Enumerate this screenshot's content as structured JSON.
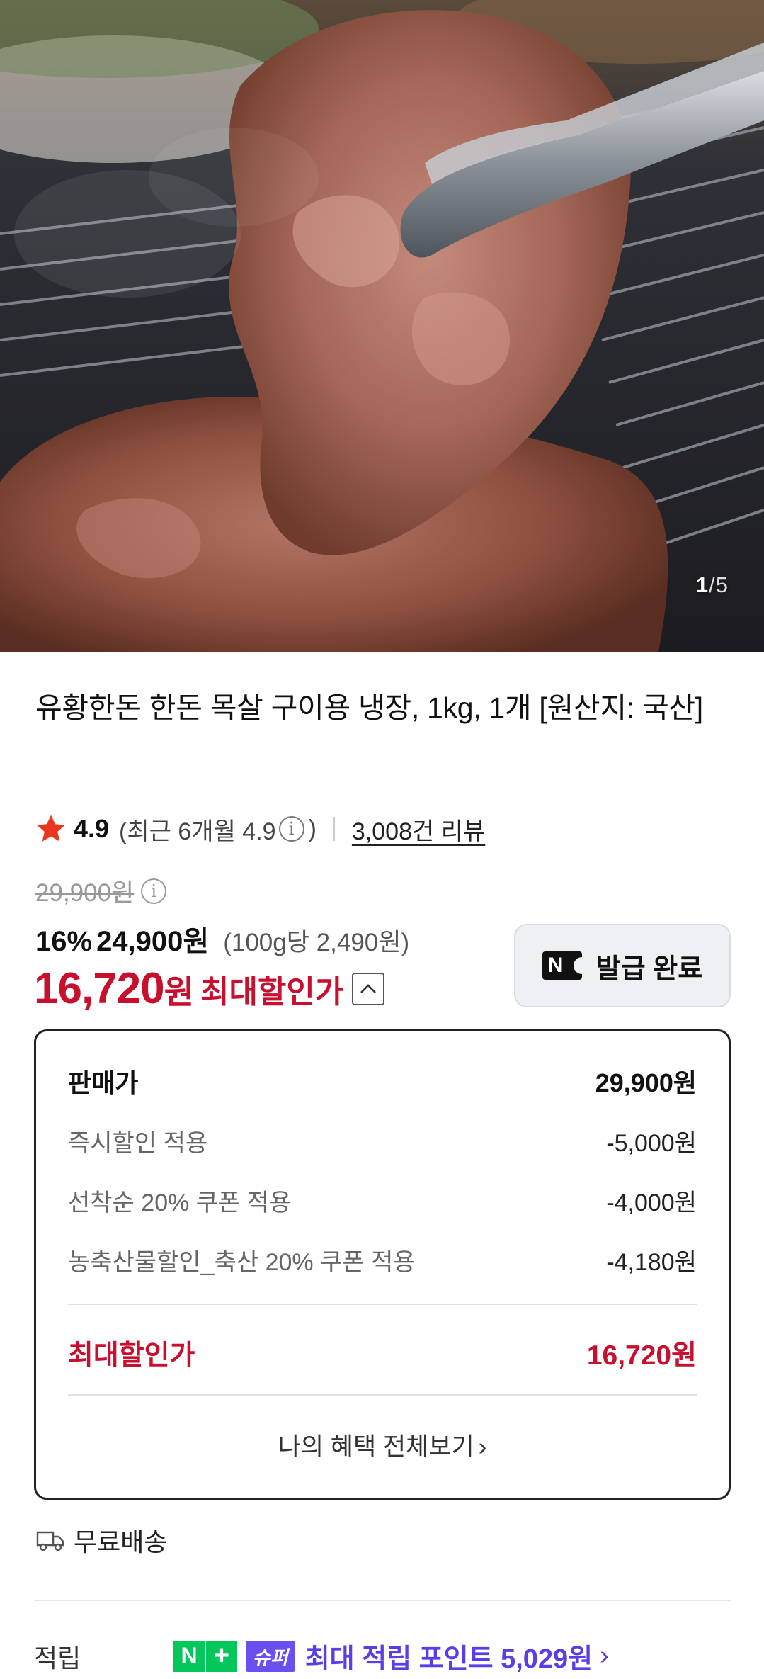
{
  "image": {
    "current": "1",
    "separator": "/",
    "total": "5"
  },
  "product": {
    "title": "유황한돈 한돈 목살 구이용 냉장, 1kg, 1개 [원산지: 국산]"
  },
  "rating": {
    "value": "4.9",
    "recent": "(최근 6개월 4.9",
    "recent_close": ")",
    "reviews": "3,008건 리뷰"
  },
  "price": {
    "original": "29,900원",
    "discount_pct": "16%",
    "sale": "24,900원",
    "unit": "(100g당 2,490원)",
    "max_number": "16,720",
    "max_unit": "원",
    "max_label": "최대할인가"
  },
  "coupon": {
    "badge": "N",
    "label": "발급 완료"
  },
  "breakdown": {
    "rows": [
      {
        "label": "판매가",
        "value": "29,900원"
      },
      {
        "label": "즉시할인 적용",
        "value": "-5,000원"
      },
      {
        "label": "선착순 20% 쿠폰 적용",
        "value": "-4,000원"
      },
      {
        "label": "농축산물할인_축산 20% 쿠폰 적용",
        "value": "-4,180원"
      }
    ],
    "total_label": "최대할인가",
    "total_value": "16,720원",
    "view_all": "나의 혜택 전체보기",
    "chevron": "›"
  },
  "shipping": {
    "label": "무료배송",
    "icon": "truck-icon"
  },
  "points": {
    "label": "적립",
    "badge_n": "N",
    "badge_plus": "+",
    "badge_super": "슈퍼",
    "text": "최대 적립 포인트 5,029원",
    "chevron": "›"
  },
  "colors": {
    "accent_red": "#c8102e",
    "naver_green": "#03c75a",
    "super_purple": "#6b4ef0",
    "star": "#e8371e"
  }
}
